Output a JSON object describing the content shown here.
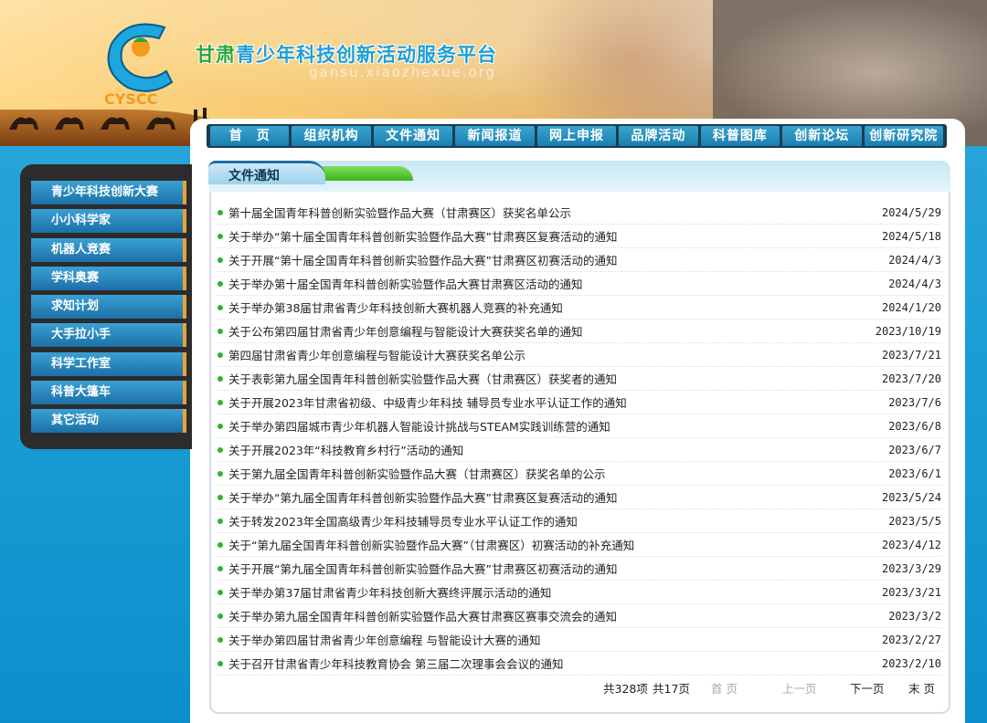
{
  "header": {
    "title_part1": "甘肃",
    "title_part2": "青少年科技创新活动服务平台",
    "subtitle": "gansu.xiaozhexue.org",
    "logo_text": "CYSCC"
  },
  "nav": [
    "首　页",
    "组织机构",
    "文件通知",
    "新闻报道",
    "网上申报",
    "品牌活动",
    "科普图库",
    "创新论坛",
    "创新研究院"
  ],
  "sidebar": [
    "青少年科技创新大赛",
    "小小科学家",
    "机器人竞赛",
    "学科奥赛",
    "求知计划",
    "大手拉小手",
    "科学工作室",
    "科普大篷车",
    "其它活动"
  ],
  "section_title": "文件通知",
  "notices": [
    {
      "title": "第十届全国青年科普创新实验暨作品大赛（甘肃赛区）获奖名单公示",
      "date": "2024/5/29"
    },
    {
      "title": "关于举办“第十届全国青年科普创新实验暨作品大赛”甘肃赛区复赛活动的通知",
      "date": "2024/5/18"
    },
    {
      "title": "关于开展“第十届全国青年科普创新实验暨作品大赛”甘肃赛区初赛活动的通知",
      "date": "2024/4/3"
    },
    {
      "title": "关于举办第十届全国青年科普创新实验暨作品大赛甘肃赛区活动的通知",
      "date": "2024/4/3"
    },
    {
      "title": "关于举办第38届甘肃省青少年科技创新大赛机器人竞赛的补充通知",
      "date": "2024/1/20"
    },
    {
      "title": "关于公布第四届甘肃省青少年创意编程与智能设计大赛获奖名单的通知",
      "date": "2023/10/19"
    },
    {
      "title": "第四届甘肃省青少年创意编程与智能设计大赛获奖名单公示",
      "date": "2023/7/21"
    },
    {
      "title": "关于表彰第九届全国青年科普创新实验暨作品大赛（甘肃赛区）获奖者的通知",
      "date": "2023/7/20"
    },
    {
      "title": "关于开展2023年甘肃省初级、中级青少年科技  辅导员专业水平认证工作的通知",
      "date": "2023/7/6"
    },
    {
      "title": "关于举办第四届城市青少年机器人智能设计挑战与STEAM实践训练营的通知",
      "date": "2023/6/8"
    },
    {
      "title": "关于开展2023年“科技教育乡村行”活动的通知",
      "date": "2023/6/7"
    },
    {
      "title": "关于第九届全国青年科普创新实验暨作品大赛（甘肃赛区）获奖名单的公示",
      "date": "2023/6/1"
    },
    {
      "title": "关于举办“第九届全国青年科普创新实验暨作品大赛”甘肃赛区复赛活动的通知",
      "date": "2023/5/24"
    },
    {
      "title": "关于转发2023年全国高级青少年科技辅导员专业水平认证工作的通知",
      "date": "2023/5/5"
    },
    {
      "title": "关于“第九届全国青年科普创新实验暨作品大赛”（甘肃赛区）初赛活动的补充通知",
      "date": "2023/4/12"
    },
    {
      "title": "关于开展“第九届全国青年科普创新实验暨作品大赛”甘肃赛区初赛活动的通知",
      "date": "2023/3/29"
    },
    {
      "title": "关于举办第37届甘肃省青少年科技创新大赛终评展示活动的通知",
      "date": "2023/3/21"
    },
    {
      "title": "关于举办第九届全国青年科普创新实验暨作品大赛甘肃赛区赛事交流会的通知",
      "date": "2023/3/2"
    },
    {
      "title": "关于举办第四届甘肃省青少年创意编程  与智能设计大赛的通知",
      "date": "2023/2/27"
    },
    {
      "title": "关于召开甘肃省青少年科技教育协会 第三届二次理事会会议的通知",
      "date": "2023/2/10"
    }
  ],
  "pager": {
    "total": "共328项",
    "pages": "共17页",
    "first": "首 页",
    "prev": "上一页",
    "next": "下一页",
    "last": "末 页"
  },
  "colors": {
    "accent": "#1f9fd6",
    "nav_dark": "#1b3d52",
    "bullet": "#2cb52c"
  }
}
